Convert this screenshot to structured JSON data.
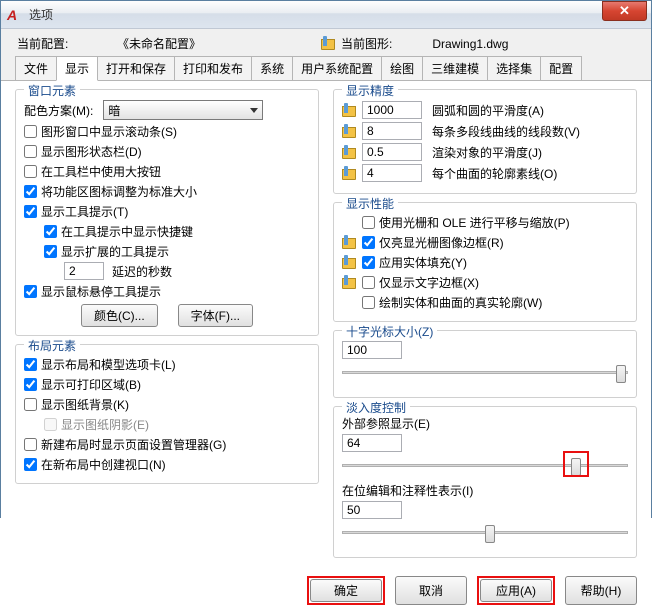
{
  "window": {
    "title": "选项"
  },
  "config_bar": {
    "current_profile_label": "当前配置:",
    "profile_name": "《未命名配置》",
    "current_drawing_label": "当前图形:",
    "drawing_name": "Drawing1.dwg"
  },
  "tabs": [
    "文件",
    "显示",
    "打开和保存",
    "打印和发布",
    "系统",
    "用户系统配置",
    "绘图",
    "三维建模",
    "选择集",
    "配置"
  ],
  "active_tab_index": 1,
  "window_elements": {
    "title": "窗口元素",
    "color_scheme_label": "配色方案(M):",
    "color_scheme_value": "暗",
    "scrollbars": "图形窗口中显示滚动条(S)",
    "status_bar": "显示图形状态栏(D)",
    "large_buttons": "在工具栏中使用大按钮",
    "ribbon_icons": "将功能区图标调整为标准大小",
    "tooltips": "显示工具提示(T)",
    "shortcut_keys": "在工具提示中显示快捷键",
    "ext_tooltips": "显示扩展的工具提示",
    "delay_value": "2",
    "delay_label": "延迟的秒数",
    "hover_tips": "显示鼠标悬停工具提示",
    "color_btn": "颜色(C)...",
    "font_btn": "字体(F)..."
  },
  "layout_elements": {
    "title": "布局元素",
    "tabs_chk": "显示布局和模型选项卡(L)",
    "print_area": "显示可打印区域(B)",
    "paper_bg": "显示图纸背景(K)",
    "paper_shadow": "显示图纸阴影(E)",
    "page_setup": "新建布局时显示页面设置管理器(G)",
    "viewport": "在新布局中创建视口(N)"
  },
  "precision": {
    "title": "显示精度",
    "arc": {
      "value": "1000",
      "label": "圆弧和圆的平滑度(A)"
    },
    "polyline": {
      "value": "8",
      "label": "每条多段线曲线的线段数(V)"
    },
    "render": {
      "value": "0.5",
      "label": "渲染对象的平滑度(J)"
    },
    "surface": {
      "value": "4",
      "label": "每个曲面的轮廓素线(O)"
    }
  },
  "performance": {
    "title": "显示性能",
    "raster_pan": "使用光栅和 OLE 进行平移与缩放(P)",
    "highlight_raster": "仅亮显光栅图像边框(R)",
    "solid_fill": "应用实体填充(Y)",
    "text_boundary": "仅显示文字边框(X)",
    "true_silhouette": "绘制实体和曲面的真实轮廓(W)"
  },
  "crosshair": {
    "title": "十字光标大小(Z)",
    "value": "100"
  },
  "fade": {
    "title": "淡入度控制",
    "xref_label": "外部参照显示(E)",
    "xref_value": "64",
    "inplace_label": "在位编辑和注释性表示(I)",
    "inplace_value": "50"
  },
  "footer": {
    "ok": "确定",
    "cancel": "取消",
    "apply": "应用(A)",
    "help": "帮助(H)"
  }
}
